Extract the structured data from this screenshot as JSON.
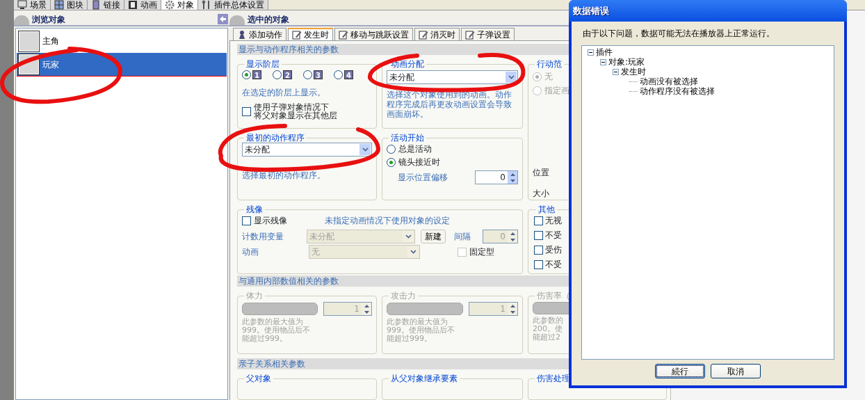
{
  "top_tabs": [
    {
      "label": "场景",
      "selected": false
    },
    {
      "label": "图块",
      "selected": false
    },
    {
      "label": "链接",
      "selected": false
    },
    {
      "label": "动画",
      "selected": false
    },
    {
      "label": "对象",
      "selected": true
    },
    {
      "label": "插件总体设置",
      "selected": false
    }
  ],
  "browse_panel": {
    "title": "浏览对象",
    "items": [
      {
        "label": "主角",
        "selected": false
      },
      {
        "label": "玩家",
        "selected": true
      }
    ]
  },
  "selected_panel": {
    "title": "选中的对象",
    "tabs": [
      {
        "label": "添加动作",
        "selected": false
      },
      {
        "label": "发生时",
        "selected": true
      },
      {
        "label": "移动与跳跃设置",
        "selected": false
      },
      {
        "label": "消灭时",
        "selected": false
      },
      {
        "label": "子弹设置",
        "selected": false
      }
    ]
  },
  "display_section": {
    "header": "显示与动作程序相关的参数",
    "layer": {
      "title": "显示阶层",
      "options": [
        {
          "label": "1",
          "selected": true
        },
        {
          "label": "2",
          "selected": false
        },
        {
          "label": "3",
          "selected": false
        },
        {
          "label": "4",
          "selected": false
        }
      ],
      "hint": "在选定的阶层上显示。",
      "bullet_checkbox": {
        "lines": [
          "使用子弹对象情况下",
          "将父对象显示在其他层"
        ],
        "checked": false
      }
    },
    "animation": {
      "title": "动画分配",
      "value": "未分配",
      "hint": "选择这个对象使用到的动画。动作程序完成后再更改动画设置会导致画面崩坏。"
    },
    "action_range": {
      "title": "行动范",
      "options": [
        {
          "label": "无",
          "selected": true
        },
        {
          "label": "指定画",
          "selected": false
        }
      ],
      "position_label": "位置",
      "size_label": "大小"
    },
    "initial_program": {
      "title": "最初的动作程序",
      "value": "未分配",
      "hint": "选择最初的动作程序。"
    },
    "activity_start": {
      "title": "活动开始",
      "options": [
        {
          "label": "总是活动",
          "selected": false
        },
        {
          "label": "镜头接近时",
          "selected": true
        }
      ],
      "offset_label": "显示位置偏移",
      "offset_value": "0"
    },
    "afterimage": {
      "title": "残像",
      "show": {
        "label": "显示残像",
        "checked": false
      },
      "note": "未指定动画情况下使用对象的设定",
      "counter_label": "计数用变量",
      "counter_value": "未分配",
      "new_button": "新建",
      "interval_label": "间隔",
      "interval_value": "0",
      "animation_label": "动画",
      "animation_value": "无",
      "fixed": {
        "label": "固定型",
        "checked": false
      }
    },
    "other": {
      "title": "其他",
      "items": [
        {
          "label": "无视",
          "checked": false
        },
        {
          "label": "不受",
          "checked": false
        },
        {
          "label": "受伤",
          "checked": false
        },
        {
          "label": "不受",
          "checked": false
        }
      ]
    }
  },
  "stats_section": {
    "header": "与通用内部数值相关的参数",
    "groups": [
      {
        "title": "体力",
        "value": "1",
        "hint_lines": [
          "此参数的最大值为",
          "999。使用物品后不",
          "能超过999。"
        ]
      },
      {
        "title": "攻击力",
        "value": "1",
        "hint_lines": [
          "此参数的最大值为",
          "999。使用物品后不",
          "能超过999。"
        ]
      },
      {
        "title": "伤害率（",
        "hint_lines": [
          "此参数的",
          "200。使",
          "能超过2"
        ]
      }
    ]
  },
  "parent_section": {
    "header": "亲子关系相关参数",
    "groups": [
      "父对象",
      "从父对象继承要素",
      "伤害处理"
    ]
  },
  "dialog": {
    "title": "数据错误",
    "message": "由于以下问题，数据可能无法在播放器上正常运行。",
    "tree": [
      {
        "label": "插件",
        "expanded": true,
        "children": [
          {
            "label": "对象:玩家",
            "expanded": true,
            "children": [
              {
                "label": "发生时",
                "expanded": true,
                "children": [
                  {
                    "label": "动画没有被选择"
                  },
                  {
                    "label": "动作程序没有被选择"
                  }
                ]
              }
            ]
          }
        ]
      }
    ],
    "buttons": [
      {
        "label": "続行",
        "focused": true
      },
      {
        "label": "取消",
        "focused": false
      }
    ]
  }
}
